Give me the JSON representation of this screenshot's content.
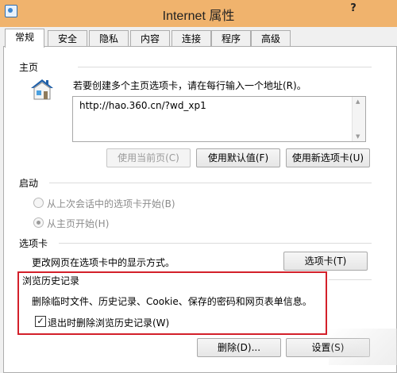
{
  "window": {
    "title": "Internet 属性",
    "help_label": "?"
  },
  "tabs": [
    {
      "label": "常规",
      "active": true
    },
    {
      "label": "安全"
    },
    {
      "label": "隐私"
    },
    {
      "label": "内容"
    },
    {
      "label": "连接"
    },
    {
      "label": "程序"
    },
    {
      "label": "高级"
    }
  ],
  "home": {
    "section_label": "主页",
    "instruction": "若要创建多个主页选项卡，请在每行输入一个地址(R)。",
    "url": "http://hao.360.cn/?wd_xp1",
    "buttons": {
      "use_current": "使用当前页(C)",
      "use_default": "使用默认值(F)",
      "use_new_tab": "使用新选项卡(U)"
    }
  },
  "startup": {
    "section_label": "启动",
    "option_last_session": "从上次会话中的选项卡开始(B)",
    "option_home": "从主页开始(H)"
  },
  "tabs_section": {
    "section_label": "选项卡",
    "description": "更改网页在选项卡中的显示方式。",
    "button": "选项卡(T)"
  },
  "history": {
    "section_label": "浏览历史记录",
    "description": "删除临时文件、历史记录、Cookie、保存的密码和网页表单信息。",
    "delete_on_exit_label": "退出时删除浏览历史记录(W)",
    "delete_on_exit_checked": true,
    "delete_button": "删除(D)...",
    "settings_button": "设置(S)"
  },
  "colors": {
    "titlebar": "#f0b36d",
    "highlight_border": "#d3202a"
  }
}
